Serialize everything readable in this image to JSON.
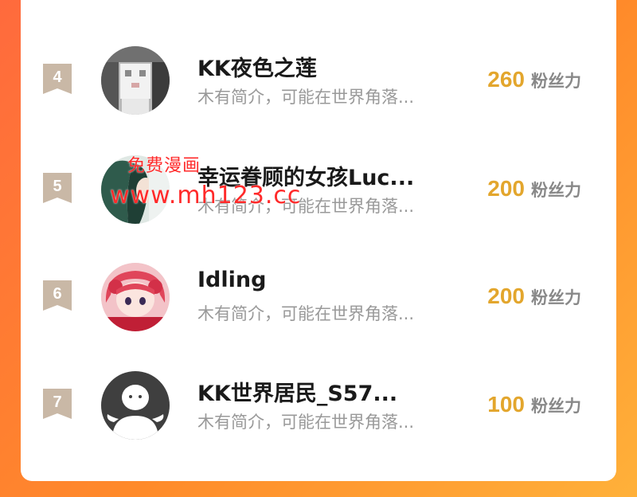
{
  "ranking": {
    "items": [
      {
        "rank": "4",
        "name": "KK夜色之莲",
        "bio": "木有简介，可能在世界角落...",
        "fans_count": "260",
        "fans_label": "粉丝力",
        "avatar": "pixelated-photo-avatar"
      },
      {
        "rank": "5",
        "name": "幸运眷顾的女孩Luc...",
        "bio": "木有简介，可能在世界角落...",
        "fans_count": "200",
        "fans_label": "粉丝力",
        "avatar": "green-hair-girl-avatar"
      },
      {
        "rank": "6",
        "name": "Idling",
        "bio": "木有简介，可能在世界角落...",
        "fans_count": "200",
        "fans_label": "粉丝力",
        "avatar": "red-hair-anime-avatar"
      },
      {
        "rank": "7",
        "name": "KK世界居民_S57...",
        "bio": "木有简介，可能在世界角落...",
        "fans_count": "100",
        "fans_label": "粉丝力",
        "avatar": "default-person-avatar"
      }
    ]
  },
  "watermark": {
    "line1": "免费漫画",
    "line2": "www.mh123.cc"
  },
  "colors": {
    "fans_count": "#e3a62d",
    "rank_badge": "#c9b8a6",
    "background_gradient_start": "#ff6a3d",
    "background_gradient_end": "#ffb13a"
  }
}
